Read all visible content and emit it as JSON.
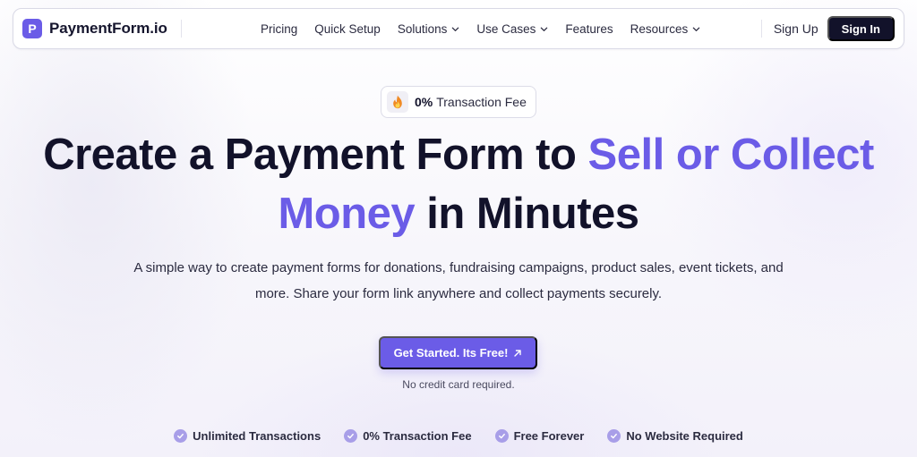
{
  "header": {
    "logo_letter": "P",
    "brand": "PaymentForm.io",
    "nav": [
      {
        "label": "Pricing",
        "dropdown": false
      },
      {
        "label": "Quick Setup",
        "dropdown": false
      },
      {
        "label": "Solutions",
        "dropdown": true
      },
      {
        "label": "Use Cases",
        "dropdown": true
      },
      {
        "label": "Features",
        "dropdown": false
      },
      {
        "label": "Resources",
        "dropdown": true
      }
    ],
    "sign_up": "Sign Up",
    "sign_in": "Sign In"
  },
  "badge": {
    "icon": "fire-icon",
    "strong": "0%",
    "text": "Transaction Fee"
  },
  "hero": {
    "title_part1": "Create a Payment Form to ",
    "title_accent": "Sell or Collect Money",
    "title_part2": " in Minutes",
    "subtitle_line1": "A simple way to create payment forms for donations, fundraising campaigns, product sales, event tickets, and",
    "subtitle_line2": "more. Share your form link anywhere and collect payments securely.",
    "cta": "Get Started. Its Free!",
    "cta_icon": "arrow-up-right-icon",
    "note": "No credit card required."
  },
  "features": [
    {
      "label": "Unlimited Transactions"
    },
    {
      "label": "0% Transaction Fee"
    },
    {
      "label": "Free Forever"
    },
    {
      "label": "No Website Required"
    }
  ],
  "colors": {
    "accent": "#6b5ce7",
    "dark": "#12122a",
    "check": "#a89ee8"
  }
}
